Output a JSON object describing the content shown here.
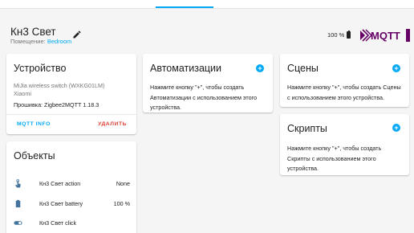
{
  "header": {
    "title": "Кн3 Свет",
    "area_prefix": "Помещение: ",
    "area_name": "Bedroom",
    "battery_level": "100 %",
    "logo_text": "MQTT"
  },
  "device_card": {
    "title": "Устройство",
    "model": "MiJia wireless switch (WXKG01LM)",
    "manufacturer": "Xiaomi",
    "firmware": "Прошивка: Zigbee2MQTT 1.18.3",
    "mqtt_info_label": "MQTT INFO",
    "delete_label": "УДАЛИТЬ"
  },
  "entities_card": {
    "title": "Объекты",
    "rows": [
      {
        "name": "Кн3 Свет action",
        "state": "None",
        "icon": "gesture-tap-icon"
      },
      {
        "name": "Кн3 Свет battery",
        "state": "100 %",
        "icon": "battery-icon"
      },
      {
        "name": "Кн3 Свет click",
        "state": "",
        "icon": "toggle-icon"
      }
    ]
  },
  "automations_card": {
    "title": "Автоматизации",
    "text": "Нажмите кнопку \"+\", чтобы создать Автоматизации с использованием этого устройства."
  },
  "scenes_card": {
    "title": "Сцены",
    "text": "Нажмите кнопку \"+\", чтобы создать Сцены с использованием этого устройства."
  },
  "scripts_card": {
    "title": "Скрипты",
    "text": "Нажмите кнопку \"+\", чтобы создать Скрипты с использованием этого устройства."
  },
  "colors": {
    "accent": "#03a9f4",
    "danger": "#db4437",
    "background": "#f5f5f5"
  }
}
